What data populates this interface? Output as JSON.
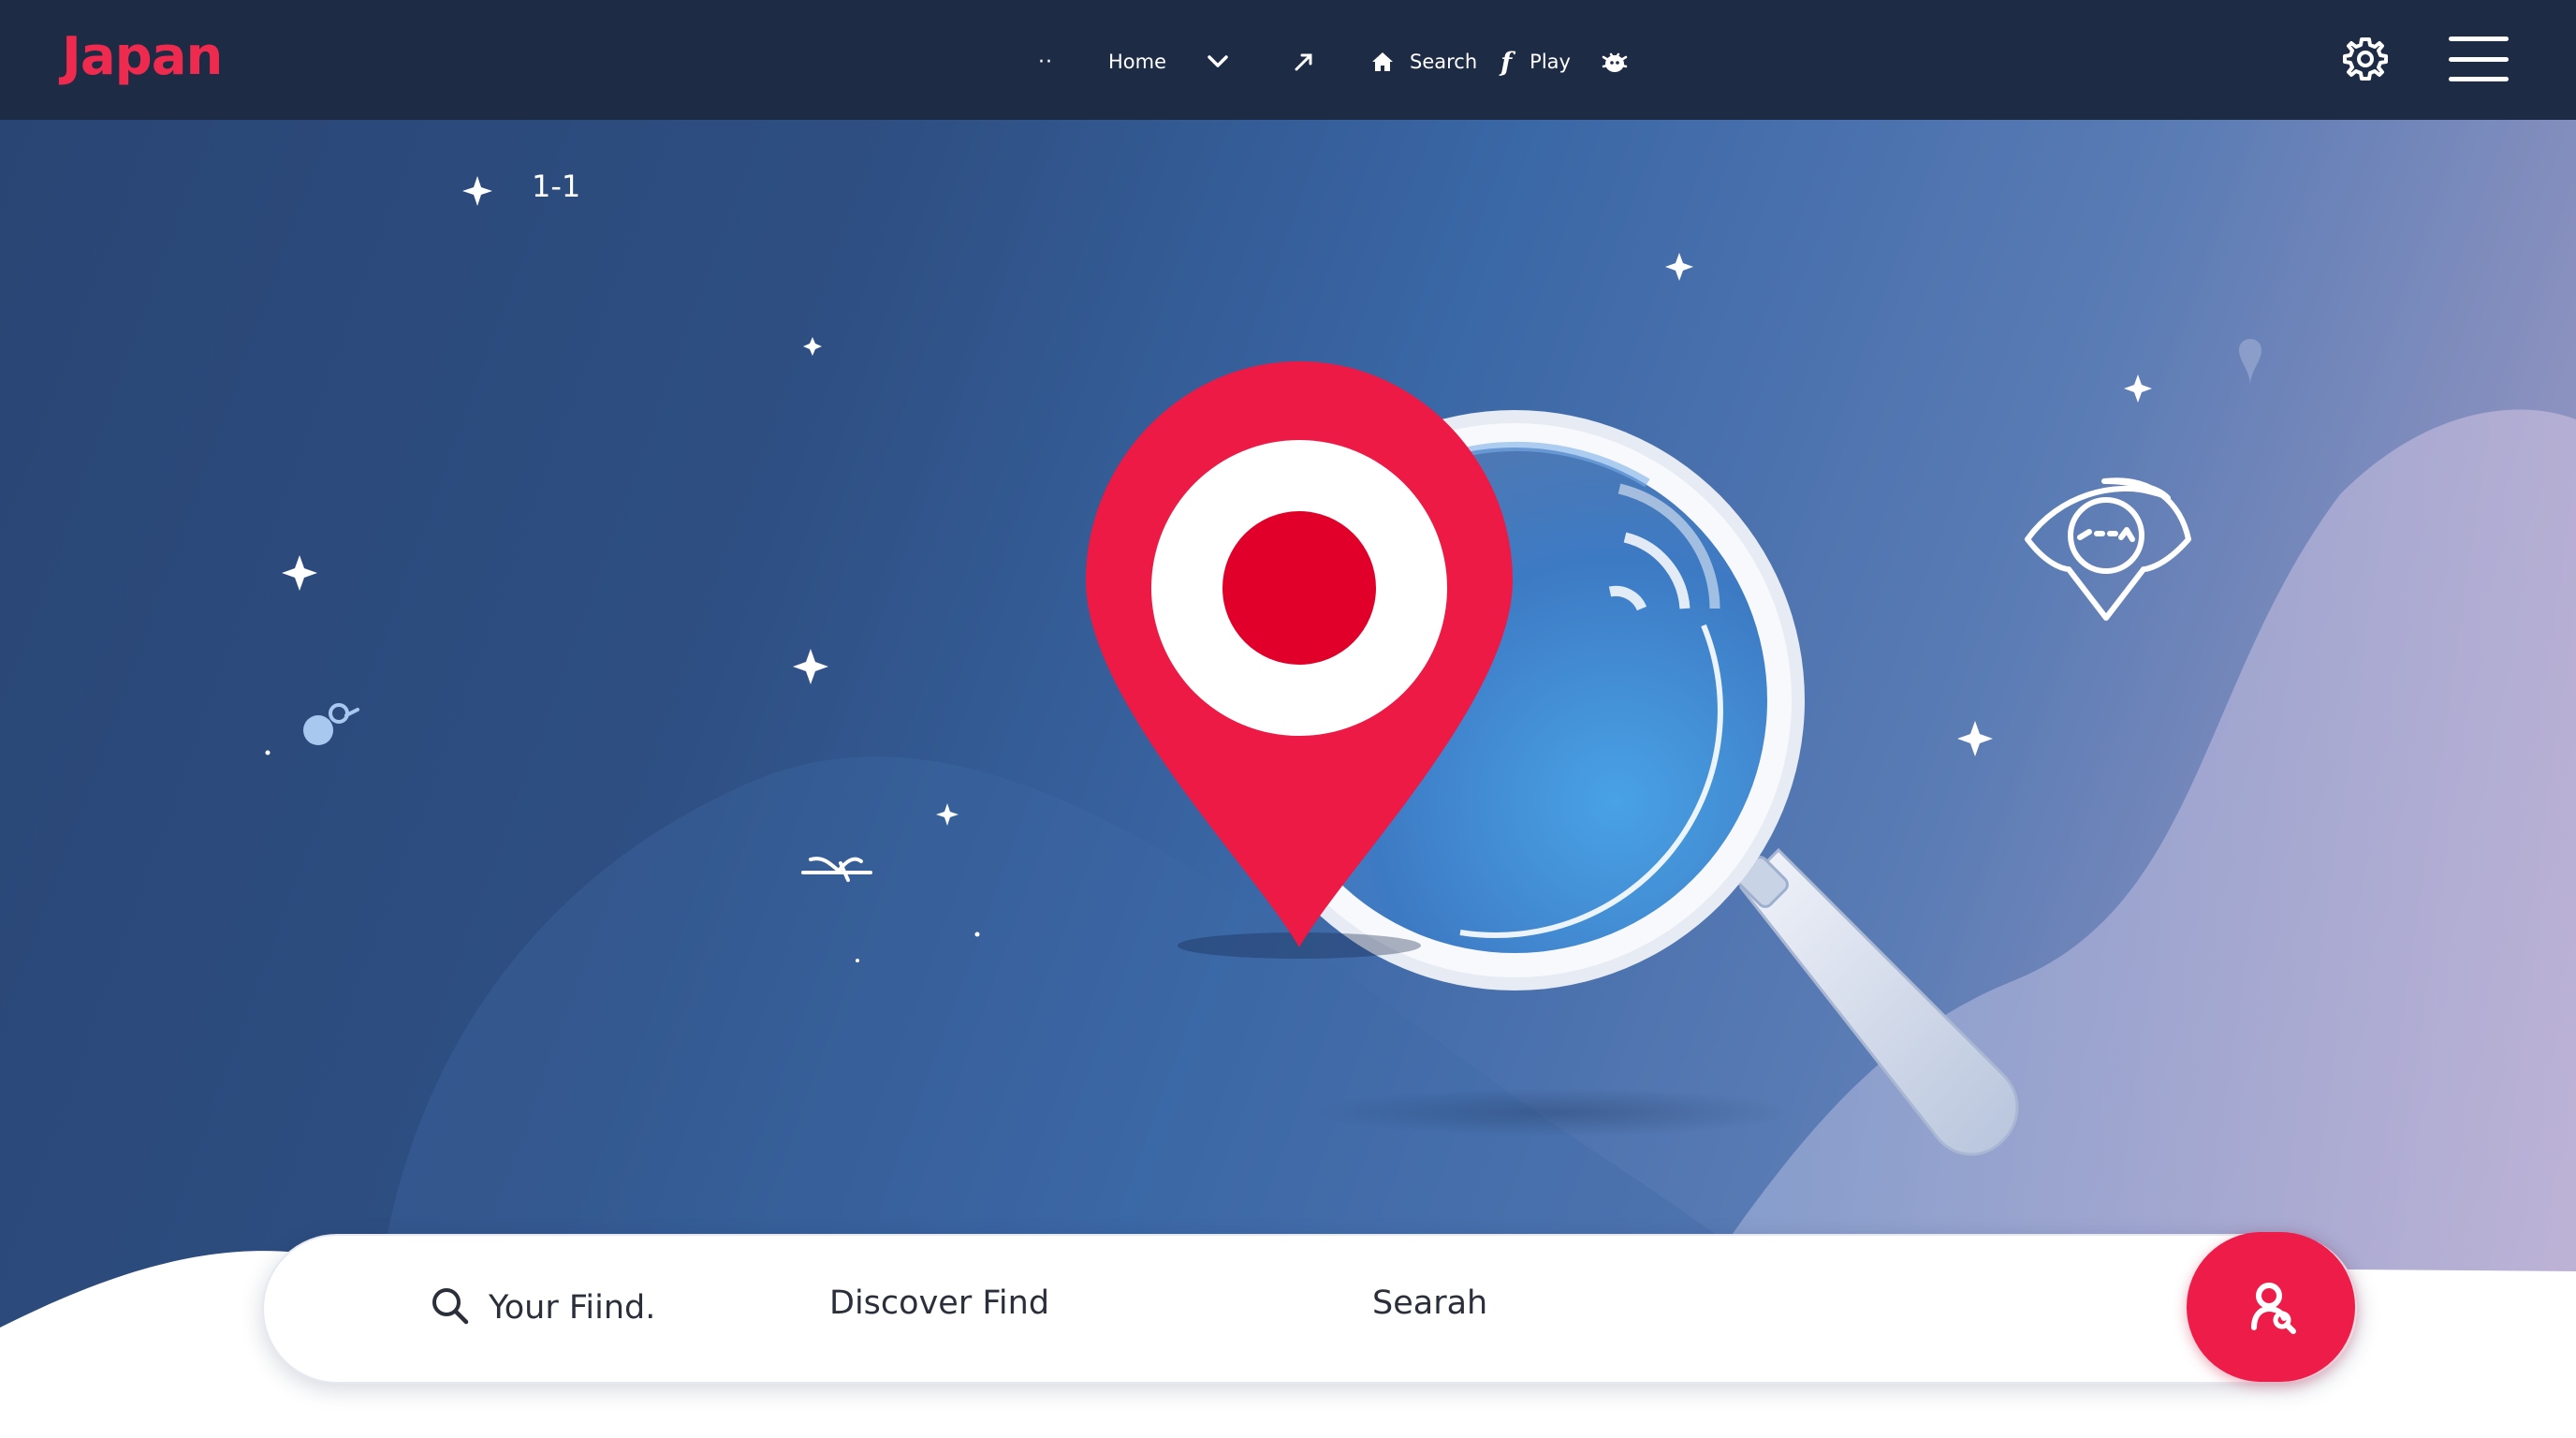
{
  "app": {
    "brand": "Japan"
  },
  "nav": {
    "dots": "··",
    "home": "Home",
    "search": "Search",
    "facebook": "f",
    "play": "Play"
  },
  "hero": {
    "counter": "1-1"
  },
  "search_panel": {
    "input_placeholder": "Your Fiind.",
    "discover_label": "Discover Find",
    "search_label": "Searah"
  },
  "icons": {
    "brand_color": "#ee2b4e",
    "nav_bg": "#1e2b45",
    "pin_red": "#ec1a45",
    "pin_center": "#e0002a",
    "button_red": "#ee1c48"
  }
}
